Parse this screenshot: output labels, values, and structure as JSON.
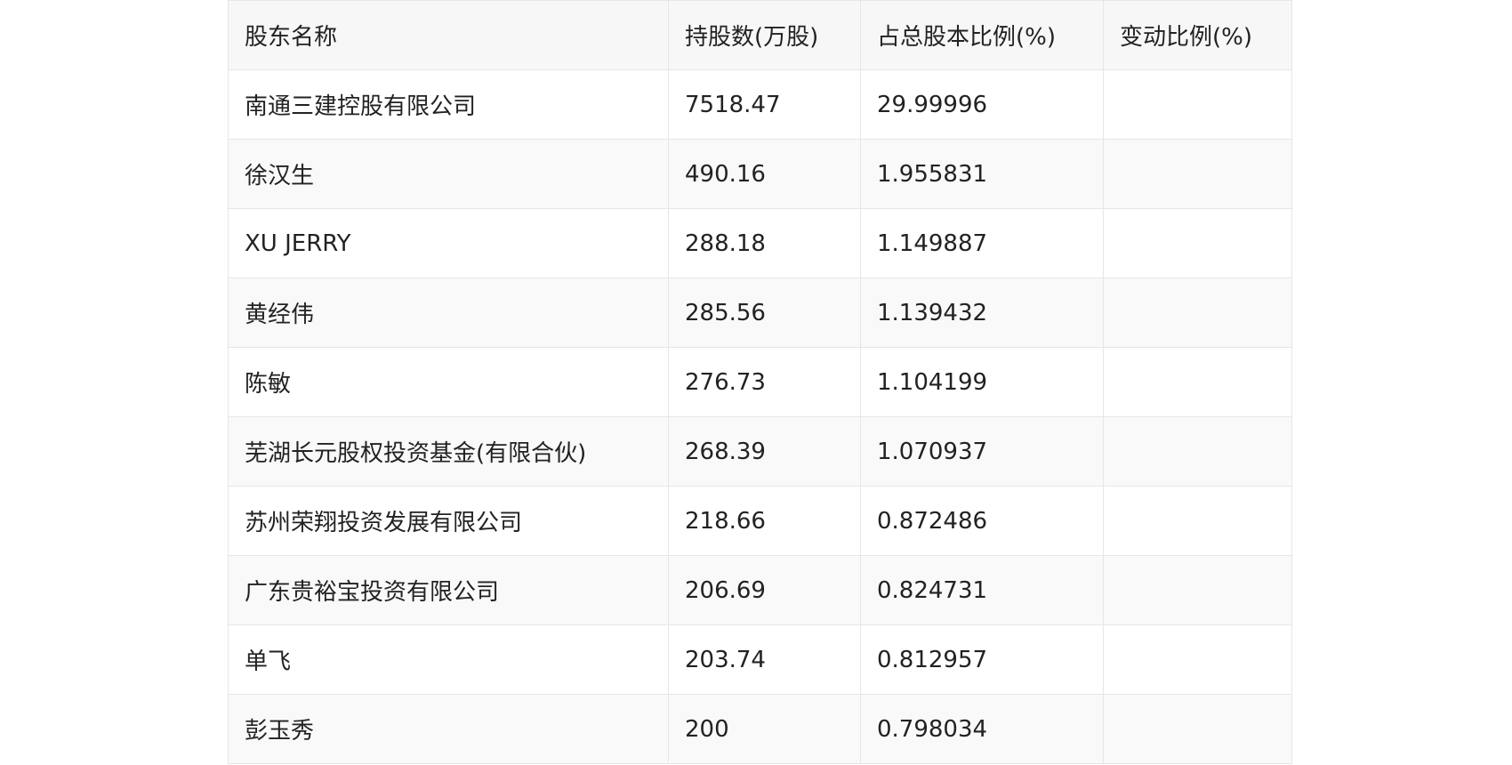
{
  "table": {
    "headers": [
      "股东名称",
      "持股数(万股)",
      "占总股本比例(%)",
      "变动比例(%)"
    ],
    "rows": [
      [
        "南通三建控股有限公司",
        "7518.47",
        "29.99996",
        ""
      ],
      [
        "徐汉生",
        "490.16",
        "1.955831",
        ""
      ],
      [
        "XU JERRY",
        "288.18",
        "1.149887",
        ""
      ],
      [
        "黄经伟",
        "285.56",
        "1.139432",
        ""
      ],
      [
        "陈敏",
        "276.73",
        "1.104199",
        ""
      ],
      [
        "芜湖长元股权投资基金(有限合伙)",
        "268.39",
        "1.070937",
        ""
      ],
      [
        "苏州荣翔投资发展有限公司",
        "218.66",
        "0.872486",
        ""
      ],
      [
        "广东贵裕宝投资有限公司",
        "206.69",
        "0.824731",
        ""
      ],
      [
        "单飞",
        "203.74",
        "0.812957",
        ""
      ],
      [
        "彭玉秀",
        "200",
        "0.798034",
        ""
      ]
    ]
  }
}
